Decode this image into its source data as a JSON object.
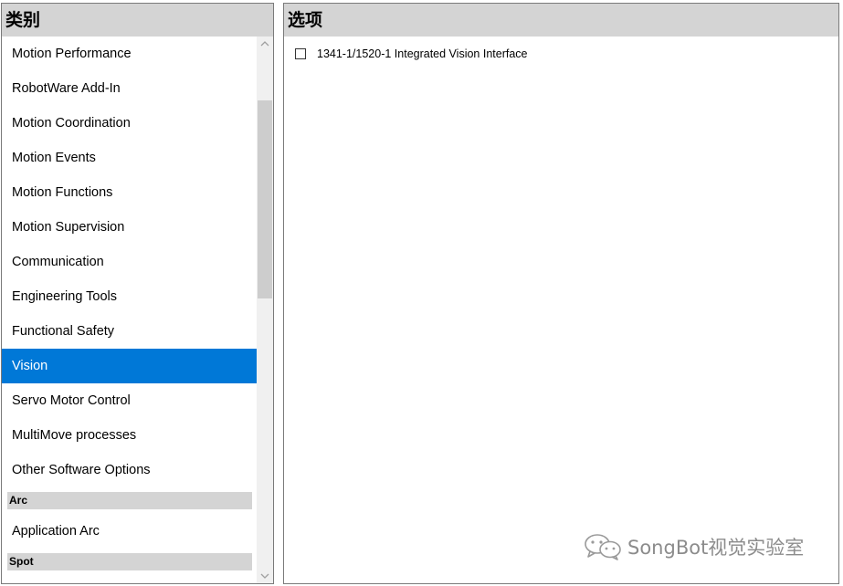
{
  "left_panel": {
    "title": "类别",
    "items": [
      {
        "label": "Motion Performance",
        "selected": false
      },
      {
        "label": "RobotWare Add-In",
        "selected": false
      },
      {
        "label": "Motion Coordination",
        "selected": false
      },
      {
        "label": "Motion Events",
        "selected": false
      },
      {
        "label": "Motion Functions",
        "selected": false
      },
      {
        "label": "Motion Supervision",
        "selected": false
      },
      {
        "label": "Communication",
        "selected": false
      },
      {
        "label": "Engineering Tools",
        "selected": false
      },
      {
        "label": "Functional Safety",
        "selected": false
      },
      {
        "label": "Vision",
        "selected": true
      },
      {
        "label": "Servo Motor Control",
        "selected": false
      },
      {
        "label": "MultiMove processes",
        "selected": false
      },
      {
        "label": "Other Software Options",
        "selected": false
      }
    ],
    "groups": [
      {
        "title": "Arc",
        "items": [
          {
            "label": "Application Arc"
          }
        ]
      },
      {
        "title": "Spot",
        "items": []
      }
    ]
  },
  "right_panel": {
    "title": "选项",
    "options": [
      {
        "label": "1341-1/1520-1 Integrated Vision Interface",
        "checked": false
      }
    ]
  },
  "watermark": {
    "text": "SongBot视觉实验室",
    "icon": "wechat-icon"
  },
  "colors": {
    "selection": "#0078d7",
    "header_bg": "#d4d4d4",
    "scrollbar_thumb": "#cdcdcd"
  }
}
